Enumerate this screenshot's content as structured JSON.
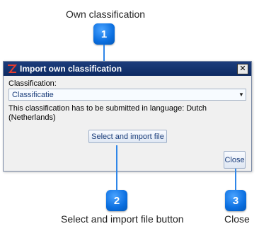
{
  "callouts": {
    "own_classification": "Own classification",
    "select_import_button": "Select and import file button",
    "close": "Close",
    "badge1": "1",
    "badge2": "2",
    "badge3": "3"
  },
  "dialog": {
    "title": "Import own classification",
    "close_glyph": "✕",
    "classification_label": "Classification:",
    "classification_value": "Classificatie",
    "hint": "This classification has to be submitted in language: Dutch (Netherlands)",
    "import_button": "Select and import file",
    "close_button": "Close"
  },
  "colors": {
    "titlebar": "#0d2a62",
    "badge": "#0b6fe0",
    "leader": "#2f86e8"
  },
  "icons": {
    "app": "app-logo-icon",
    "close": "close-icon",
    "dropdown": "chevron-down-icon"
  }
}
